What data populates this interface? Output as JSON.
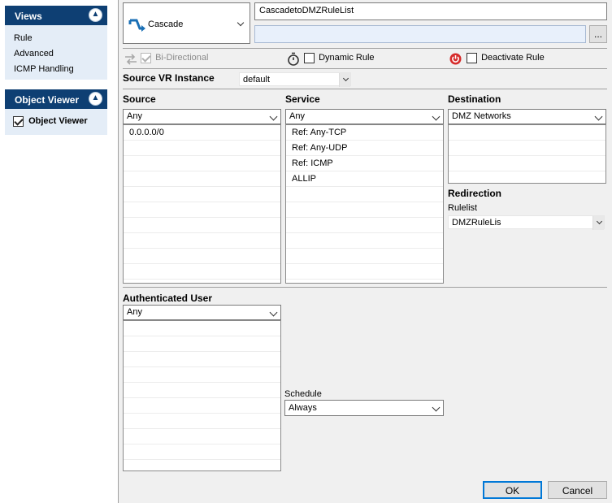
{
  "sidebar": {
    "views": {
      "title": "Views",
      "items": [
        "Rule",
        "Advanced",
        "ICMP Handling"
      ]
    },
    "object_viewer": {
      "title": "Object Viewer",
      "checkbox_label": "Object Viewer",
      "checked": true
    }
  },
  "header": {
    "action": "Cascade",
    "rule_name": "CascadetoDMZRuleList",
    "comment_value": "",
    "more_button": "..."
  },
  "options": {
    "bidirectional": {
      "label": "Bi-Directional",
      "checked": true,
      "enabled": false
    },
    "dynamic_rule": {
      "label": "Dynamic Rule",
      "checked": false
    },
    "deactivate_rule": {
      "label": "Deactivate Rule",
      "checked": false
    }
  },
  "vr_instance": {
    "label": "Source VR Instance",
    "value": "default"
  },
  "source": {
    "label": "Source",
    "selector": "Any",
    "items": [
      "0.0.0.0/0"
    ]
  },
  "service": {
    "label": "Service",
    "selector": "Any",
    "items": [
      "Ref: Any-TCP",
      "Ref: Any-UDP",
      "Ref: ICMP",
      "ALLIP"
    ]
  },
  "destination": {
    "label": "Destination",
    "selector": "DMZ Networks",
    "items": []
  },
  "redirection": {
    "label": "Redirection",
    "rulelist_label": "Rulelist",
    "rulelist_value": "DMZRuleLis"
  },
  "auth_user": {
    "label": "Authenticated User",
    "selector": "Any",
    "items": []
  },
  "schedule": {
    "label": "Schedule",
    "value": "Always"
  },
  "footer": {
    "ok": "OK",
    "cancel": "Cancel"
  },
  "colors": {
    "sidebar_header": "#0e3f73",
    "sidebar_body": "#e4edf7",
    "accent": "#0078d7",
    "deactivate_icon": "#d62b2b"
  }
}
